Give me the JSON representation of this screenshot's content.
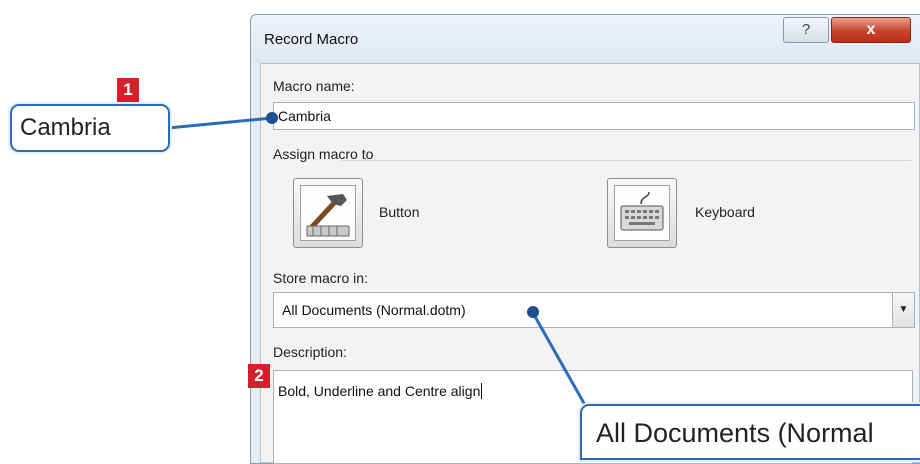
{
  "dialog": {
    "title": "Record Macro",
    "help_glyph": "?",
    "close_glyph": "x",
    "macro_name_label": "Macro name:",
    "macro_name_value": "Cambria",
    "assign_label": "Assign macro to",
    "button_label": "Button",
    "keyboard_label": "Keyboard",
    "store_label": "Store macro in:",
    "store_value": "All Documents (Normal.dotm)",
    "description_label": "Description:",
    "description_value": "Bold, Underline and Centre align"
  },
  "annotations": {
    "step1": {
      "number": "1",
      "text": "Cambria"
    },
    "step2": {
      "number": "2"
    },
    "callout2_text": "All Documents (Normal"
  },
  "colors": {
    "callout_border": "#2b6cb8",
    "badge_red": "#d3202a",
    "close_red": "#c9432a"
  }
}
